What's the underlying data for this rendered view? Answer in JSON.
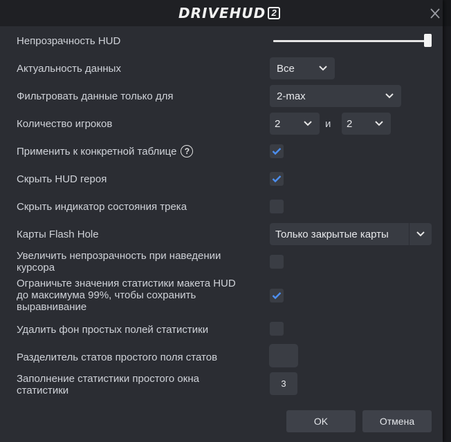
{
  "app": {
    "logo_text": "DRIVEHUD",
    "logo_badge": "2"
  },
  "rows": {
    "opacity_label": "Непрозрачность HUD",
    "opacity_value": 1.0,
    "data_relevance_label": "Актуальность данных",
    "data_relevance_value": "Все",
    "filter_label": "Фильтровать данные только для",
    "filter_value": "2-max",
    "players_label": "Количество игроков",
    "players_min": "2",
    "players_and": "и",
    "players_max": "2",
    "apply_table_label": "Применить к конкретной таблице",
    "apply_table_checked": true,
    "hide_hero_label": "Скрыть HUD героя",
    "hide_hero_checked": true,
    "hide_tracker_label": "Скрыть индикатор состояния трека",
    "hide_tracker_checked": false,
    "flash_hole_label": "Карты Flash Hole",
    "flash_hole_value": "Только закрытые карты",
    "hover_opacity_label_line1": "Увеличить непрозрачность при наведении",
    "hover_opacity_label_line2": "курсора",
    "hover_opacity_checked": false,
    "limit_stats_label_line1": "Ограничьте значения статистики макета HUD",
    "limit_stats_label_line2": "до максимума 99%, чтобы сохранить",
    "limit_stats_label_line3": "выравнивание",
    "limit_stats_checked": true,
    "remove_bg_label": "Удалить фон простых полей статистики",
    "remove_bg_checked": false,
    "separator_label": "Разделитель статов простого поля статов",
    "padding_label_line1": "Заполнение статистики простого окна",
    "padding_label_line2": "статистики",
    "padding_value": "3"
  },
  "buttons": {
    "ok": "OK",
    "cancel": "Отмена"
  },
  "colors": {
    "accent_check": "#4d8ff0",
    "dialog_bg": "#2b2d33",
    "control_bg": "#383b42"
  }
}
